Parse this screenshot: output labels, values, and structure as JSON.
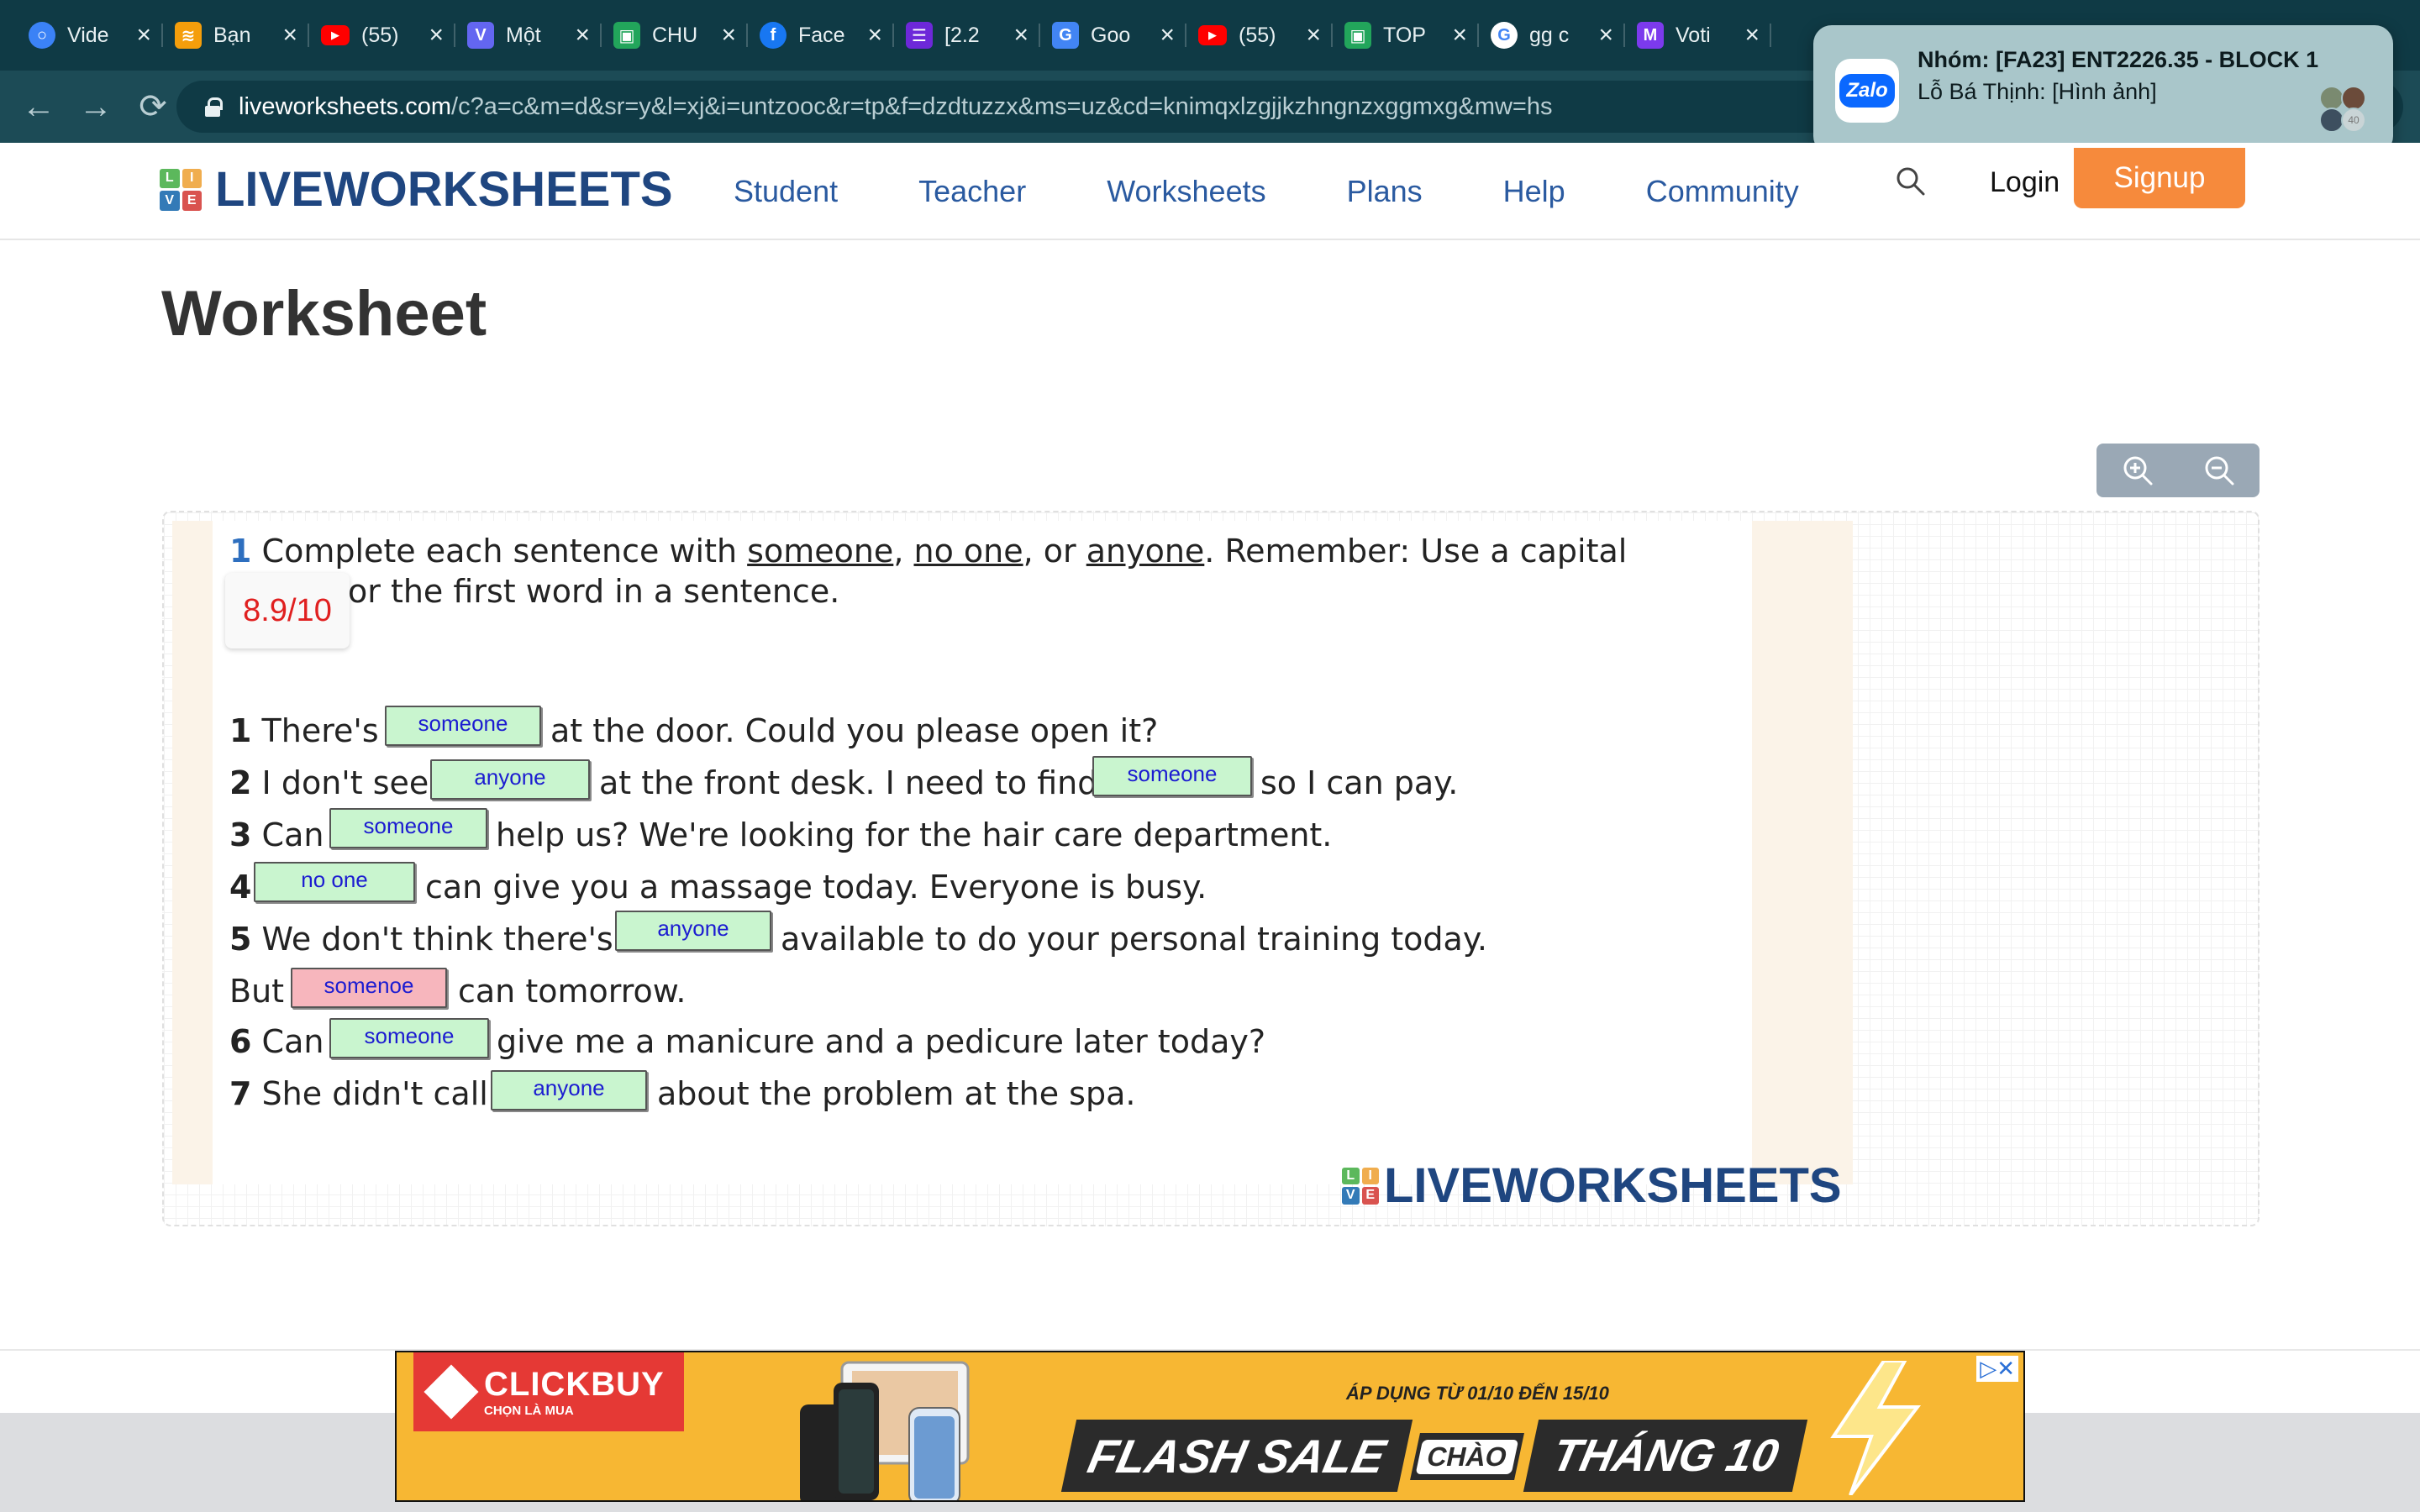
{
  "browser": {
    "tabs": [
      {
        "label": "Vide",
        "icon": "circle-icon",
        "color": "#3b82f6"
      },
      {
        "label": "Bạn",
        "icon": "stack-icon",
        "color": "#f59e0b"
      },
      {
        "label": "(55)",
        "icon": "youtube-icon",
        "color": "#ff0000"
      },
      {
        "label": "Một",
        "icon": "v-icon",
        "color": "#6366f1"
      },
      {
        "label": "CHU",
        "icon": "classroom-icon",
        "color": "#22a55b"
      },
      {
        "label": "Face",
        "icon": "facebook-icon",
        "color": "#1877f2"
      },
      {
        "label": "[2.2",
        "icon": "list-icon",
        "color": "#6d28d9"
      },
      {
        "label": "Goo",
        "icon": "translate-icon",
        "color": "#4285f4"
      },
      {
        "label": "(55)",
        "icon": "youtube-icon",
        "color": "#ff0000"
      },
      {
        "label": "TOP",
        "icon": "classroom-icon",
        "color": "#22a55b"
      },
      {
        "label": "gg c",
        "icon": "google-icon",
        "color": "#ffffff"
      },
      {
        "label": "Voti",
        "icon": "m-icon",
        "color": "#7c3aed"
      }
    ],
    "url_host": "liveworksheets.com",
    "url_path": "/c?a=c&m=d&sr=y&l=xj&i=untzooc&r=tp&f=dzdtuzzx&ms=uz&cd=knimqxlzgjjkzhngnzxggmxg&mw=hs"
  },
  "notification": {
    "app": "Zalo",
    "title": "Nhóm: [FA23] ENT2226.35 - BLOCK 1",
    "body": "Lỗ Bá Thịnh: [Hình ảnh]",
    "badge": "40"
  },
  "site": {
    "brand": "LIVEWORKSHEETS",
    "brand_letters": [
      "L",
      "I",
      "V",
      "E"
    ],
    "brand_colors": [
      "#5cb85c",
      "#f0ad4e",
      "#337ab7",
      "#d9534f"
    ],
    "nav": [
      "Student",
      "Teacher",
      "Worksheets",
      "Plans",
      "Help",
      "Community"
    ],
    "login": "Login",
    "signup": "Signup"
  },
  "page": {
    "title": "Worksheet",
    "score": "8.9/10"
  },
  "worksheet": {
    "instruction_num": "1",
    "instruction_a": "Complete each sentence with ",
    "word1": "someone",
    "sep1": ", ",
    "word2": "no one",
    "sep2": ", or ",
    "word3": "anyone",
    "instruction_b": ". Remember: Use a capital",
    "instruction_c": "or the first word in a sentence.",
    "q1": {
      "num": "1",
      "before": "There's",
      "ans": "someone",
      "after": "at the door. Could you please open it?"
    },
    "q2": {
      "num": "2",
      "before": "I don't see",
      "ans1": "anyone",
      "middle": "at the front desk. I need to find",
      "ans2": "someone",
      "after": "so I can pay."
    },
    "q3": {
      "num": "3",
      "before": "Can",
      "ans": "someone",
      "after": "help us? We're looking for the hair care department."
    },
    "q4": {
      "num": "4",
      "ans": "no one",
      "after": "can give you a massage today. Everyone is busy."
    },
    "q5": {
      "num": "5",
      "before": "We don't think there's",
      "ans": "anyone",
      "after": "available to do your personal training today."
    },
    "q5b": {
      "before": "But",
      "ans": "somenoe",
      "after": "can tomorrow."
    },
    "q6": {
      "num": "6",
      "before": "Can",
      "ans": "someone",
      "after": "give me a manicure and a pedicure later today?"
    },
    "q7": {
      "num": "7",
      "before": "She didn't call",
      "ans": "anyone",
      "after": "about the problem at the spa."
    },
    "colors": {
      "correct": "#c9f5cf",
      "incorrect": "#f7b6bd",
      "answer_text": "#1c1cd1"
    }
  },
  "ad": {
    "brand": "CLICKBUY",
    "tagline": "CHỌN LÀ MUA",
    "date": "ÁP DỤNG TỪ 01/10 ĐẾN 15/10",
    "flash": "FLASH SALE",
    "chao": "CHÀO",
    "month": "THÁNG 10"
  }
}
